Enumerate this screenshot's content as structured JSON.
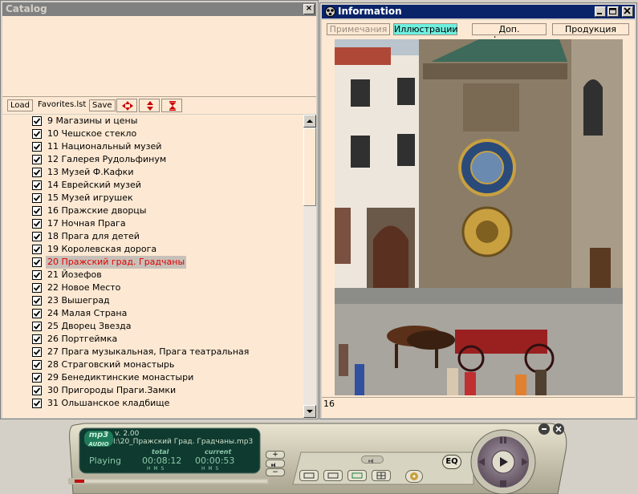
{
  "catalog": {
    "title": "Catalog",
    "close_glyph": "×",
    "toolbar": {
      "load_label": "Load",
      "favorites_label": "Favorites.lst",
      "save_label": "Save"
    },
    "items": [
      {
        "label": "9 Магазины и цены",
        "checked": true
      },
      {
        "label": "10 Чешское стекло",
        "checked": true
      },
      {
        "label": "11 Национальный музей",
        "checked": true
      },
      {
        "label": "12 Галерея Рудольфинум",
        "checked": true
      },
      {
        "label": "13 Музей Ф.Кафки",
        "checked": true
      },
      {
        "label": "14 Еврейский музей",
        "checked": true
      },
      {
        "label": "15 Музей игрушек",
        "checked": true
      },
      {
        "label": "16 Пражские дворцы",
        "checked": true
      },
      {
        "label": "17 Ночная Прага",
        "checked": true
      },
      {
        "label": "18 Прага для детей",
        "checked": true
      },
      {
        "label": "19 Королевская дорога",
        "checked": true
      },
      {
        "label": "20 Пражский град. Градчаны",
        "checked": true,
        "selected": true
      },
      {
        "label": "21 Йозефов",
        "checked": true
      },
      {
        "label": "22 Новое Место",
        "checked": true
      },
      {
        "label": "23 Вышеград",
        "checked": true
      },
      {
        "label": "24 Малая Страна",
        "checked": true
      },
      {
        "label": "25 Дворец Звезда",
        "checked": true
      },
      {
        "label": "26 Портгеймка",
        "checked": true
      },
      {
        "label": "27 Прага музыкальная, Прага театральная",
        "checked": true
      },
      {
        "label": "28 Страговский монастырь",
        "checked": true
      },
      {
        "label": "29 Бенедиктинские монастыри",
        "checked": true
      },
      {
        "label": "30 Пригороды Праги.Замки",
        "checked": true
      },
      {
        "label": "31 Ольшанское кладбище",
        "checked": true
      }
    ]
  },
  "information": {
    "title": "Information",
    "tabs": [
      {
        "label": "Примечания",
        "state": "inactive"
      },
      {
        "label": "Иллюстрации",
        "state": "active"
      },
      {
        "label": "Доп. информация",
        "state": "normal"
      },
      {
        "label": "Продукция",
        "state": "normal"
      }
    ],
    "caption": "16"
  },
  "player": {
    "format": "mp3",
    "audio_badge": "AUDIO",
    "version": "v. 2.00",
    "file": "I:\\20_Пражский Град. Градчаны.mp3",
    "status": "Playing",
    "total_label": "total",
    "current_label": "current",
    "total_time": "00:08:12",
    "current_time": "00:00:53",
    "hms": "H  M  S",
    "eq_label": "EQ",
    "progress": 0.05
  }
}
